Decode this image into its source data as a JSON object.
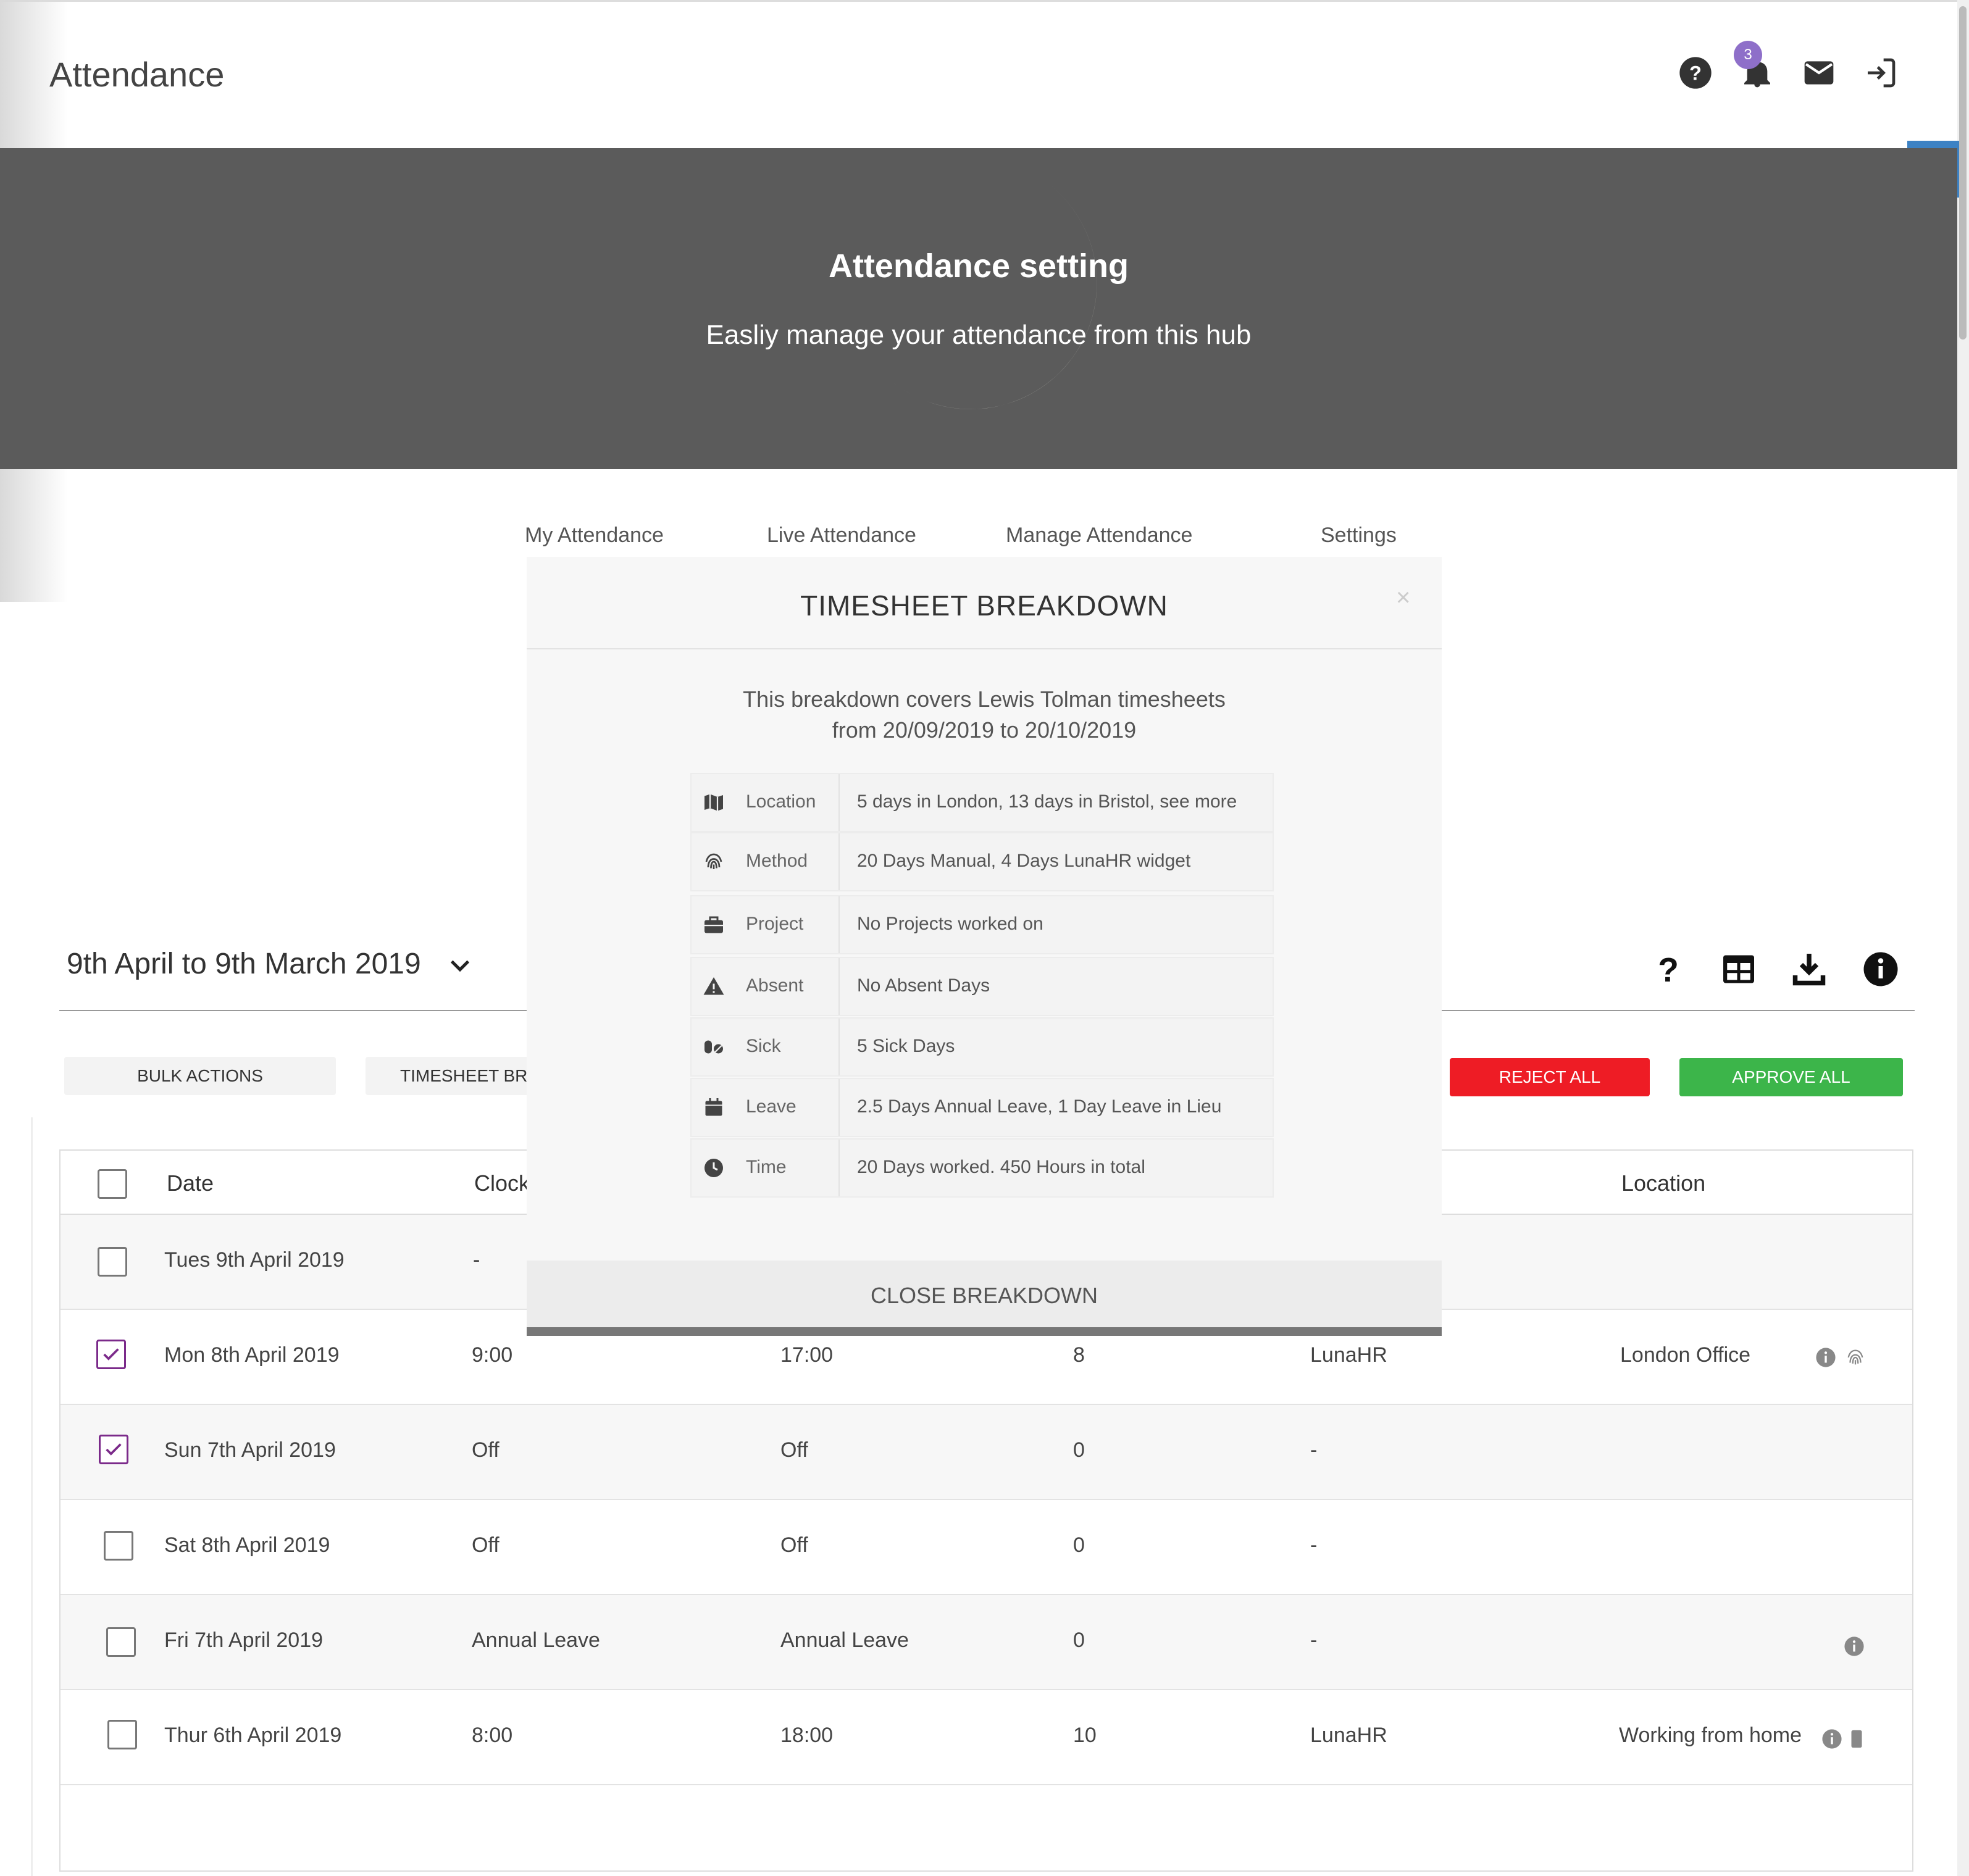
{
  "header": {
    "title": "Attendance",
    "notification_count": "3",
    "icons": [
      "help-icon",
      "bell-icon",
      "mail-icon",
      "logout-icon"
    ]
  },
  "hero": {
    "title": "Attendance setting",
    "subtitle": "Easliy manage your attendance from this hub"
  },
  "tabs": [
    {
      "label": "My Attendance"
    },
    {
      "label": "Live Attendance"
    },
    {
      "label": "Manage Attendance"
    },
    {
      "label": "Settings"
    }
  ],
  "toolbar": {
    "date_range": "9th April to 9th March 2019",
    "bulk_actions": "BULK ACTIONS",
    "timesheet_breakdown": "TIMESHEET BR",
    "reject_all": "REJECT ALL",
    "approve_all": "APPROVE ALL",
    "reject_color": "#ee1c25",
    "approve_color": "#3cb54a"
  },
  "table": {
    "headers": [
      "Date",
      "Clock",
      "Location"
    ],
    "rows": [
      {
        "checked": false,
        "date": "Tues 9th April 2019",
        "clock_in": "-",
        "clock_out": "",
        "hours": "",
        "method": "",
        "location": ""
      },
      {
        "checked": true,
        "date": "Mon 8th April 2019",
        "clock_in": "9:00",
        "clock_out": "17:00",
        "hours": "8",
        "method": "LunaHR",
        "location": "London Office"
      },
      {
        "checked": true,
        "date": "Sun 7th April 2019",
        "clock_in": "Off",
        "clock_out": "Off",
        "hours": "0",
        "method": "-",
        "location": ""
      },
      {
        "checked": false,
        "date": "Sat 8th April 2019",
        "clock_in": "Off",
        "clock_out": "Off",
        "hours": "0",
        "method": "-",
        "location": ""
      },
      {
        "checked": false,
        "date": "Fri 7th April 2019",
        "clock_in": "Annual Leave",
        "clock_out": "Annual Leave",
        "hours": "0",
        "method": "-",
        "location": ""
      },
      {
        "checked": false,
        "date": "Thur 6th April 2019",
        "clock_in": "8:00",
        "clock_out": "18:00",
        "hours": "10",
        "method": "LunaHR",
        "location": "Working from home"
      }
    ]
  },
  "modal": {
    "title": "TIMESHEET BREAKDOWN",
    "close_symbol": "×",
    "desc_line1": "This breakdown covers Lewis Tolman timesheets",
    "desc_line2": "from 20/09/2019 to 20/10/2019",
    "rows": [
      {
        "icon": "map-icon",
        "label": "Location",
        "value": "5 days in London, 13 days in Bristol, see more"
      },
      {
        "icon": "fingerprint-icon",
        "label": "Method",
        "value": "20 Days Manual, 4 Days LunaHR widget"
      },
      {
        "icon": "briefcase-icon",
        "label": "Project",
        "value": "No Projects worked on"
      },
      {
        "icon": "warning-icon",
        "label": "Absent",
        "value": "No Absent Days"
      },
      {
        "icon": "pills-icon",
        "label": "Sick",
        "value": "5 Sick Days"
      },
      {
        "icon": "calendar-icon",
        "label": "Leave",
        "value": "2.5 Days Annual Leave, 1 Day Leave in Lieu"
      },
      {
        "icon": "clock-icon",
        "label": "Time",
        "value": "20 Days worked. 450 Hours in total"
      }
    ],
    "close_button": "CLOSE BREAKDOWN"
  }
}
